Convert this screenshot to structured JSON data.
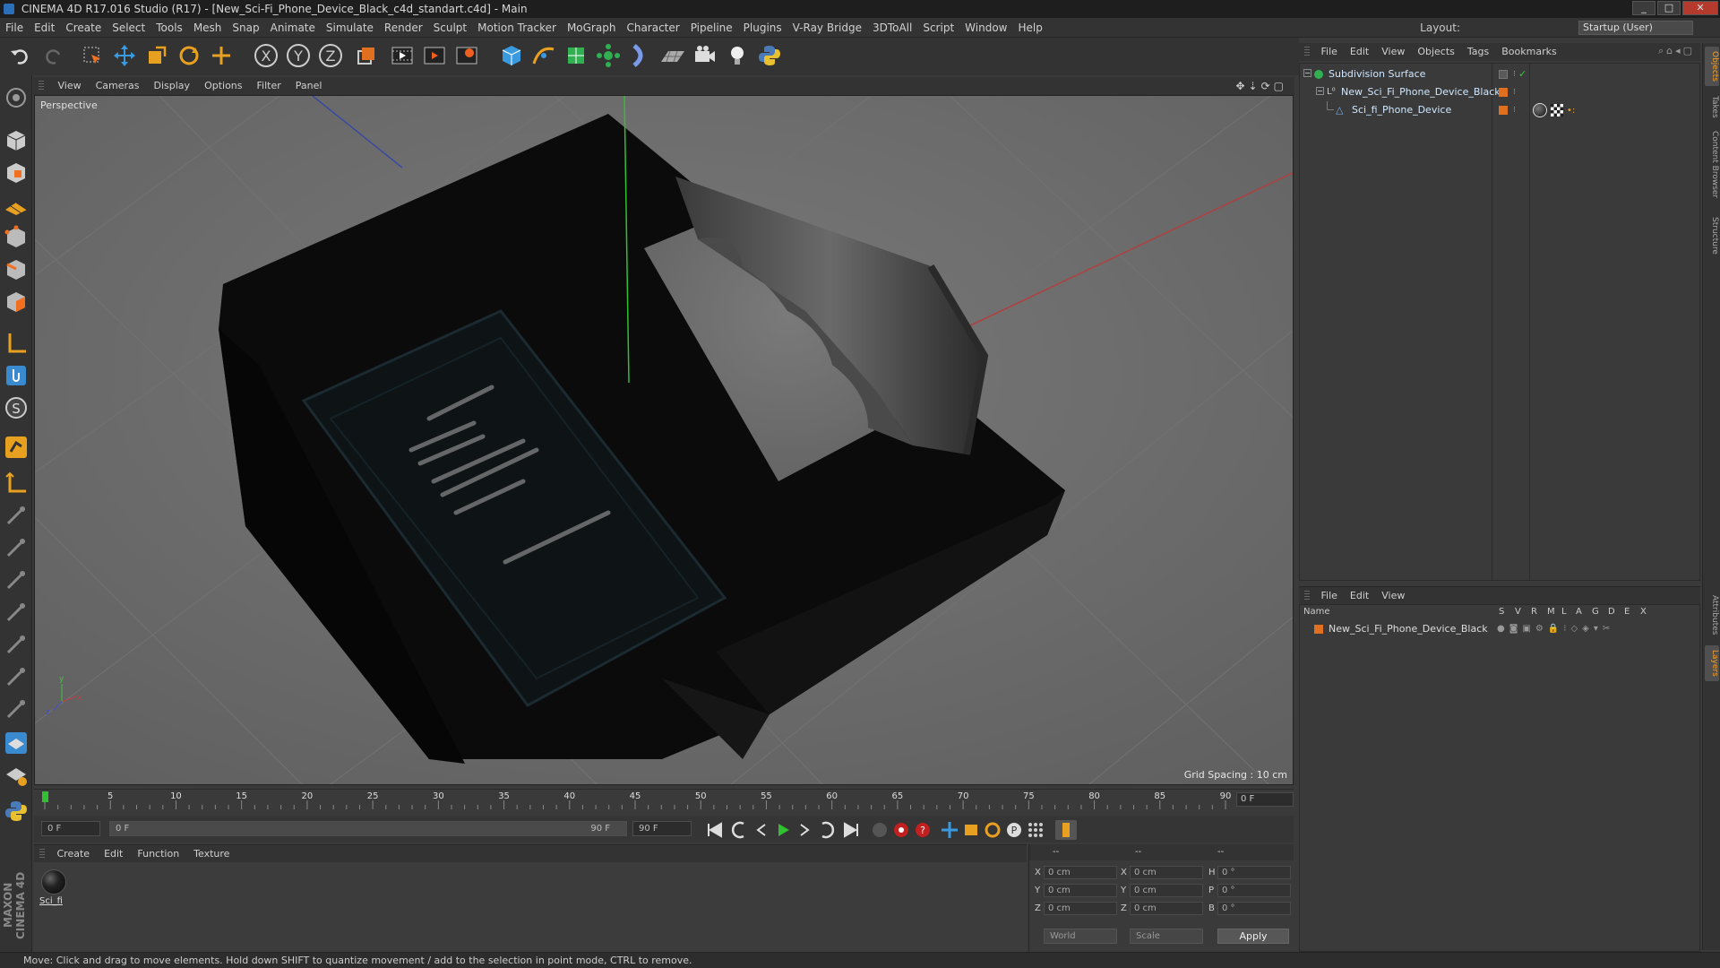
{
  "window": {
    "title": "CINEMA 4D R17.016 Studio (R17) - [New_Sci-Fi_Phone_Device_Black_c4d_standart.c4d] - Main",
    "min": "_",
    "max": "□",
    "close": "✕"
  },
  "menubar": {
    "items": [
      "File",
      "Edit",
      "Create",
      "Select",
      "Tools",
      "Mesh",
      "Snap",
      "Animate",
      "Simulate",
      "Render",
      "Sculpt",
      "Motion Tracker",
      "MoGraph",
      "Character",
      "Pipeline",
      "Plugins",
      "V-Ray Bridge",
      "3DToAll",
      "Script",
      "Window",
      "Help"
    ],
    "layout_label": "Layout:",
    "layout_value": "Startup (User)"
  },
  "toolbar": {
    "tools": [
      "undo-icon",
      "redo-icon",
      "live-select-icon",
      "move-icon",
      "scale-icon",
      "rotate-icon",
      "recent-tool-icon",
      "x-axis-icon",
      "y-axis-icon",
      "z-axis-icon",
      "coordinate-system-icon",
      "render-view-icon",
      "render-picture-viewer-icon",
      "edit-render-settings-icon",
      "cube-icon",
      "spline-pen-icon",
      "subdivision-icon",
      "array-icon",
      "deformer-icon",
      "floor-icon",
      "camera-icon",
      "light-icon",
      "python-icon"
    ],
    "x_label": "X",
    "y_label": "Y",
    "z_label": "Z"
  },
  "viewport": {
    "menu": [
      "View",
      "Cameras",
      "Display",
      "Options",
      "Filter",
      "Panel"
    ],
    "label": "Perspective",
    "grid_spacing": "Grid Spacing : 10 cm",
    "axis_x": "x",
    "axis_y": "y",
    "axis_z": "z"
  },
  "timeline": {
    "ticks": [
      "0",
      "5",
      "10",
      "15",
      "20",
      "25",
      "30",
      "35",
      "40",
      "45",
      "50",
      "55",
      "60",
      "65",
      "70",
      "75",
      "80",
      "85",
      "90"
    ],
    "current_frame": "0 F"
  },
  "transport": {
    "start_field": "0 F",
    "range_start": "0 F",
    "range_end": "90 F",
    "end_field": "90 F"
  },
  "material_manager": {
    "menu": [
      "Create",
      "Edit",
      "Function",
      "Texture"
    ],
    "materials": [
      {
        "name": "Sci_fi"
      }
    ]
  },
  "coordinates": {
    "headers": [
      "--",
      "--",
      "--"
    ],
    "rows": [
      {
        "axis": "X",
        "pos": "0 cm",
        "size_axis": "X",
        "size": "0 cm",
        "rot_axis": "H",
        "rot": "0 °"
      },
      {
        "axis": "Y",
        "pos": "0 cm",
        "size_axis": "Y",
        "size": "0 cm",
        "rot_axis": "P",
        "rot": "0 °"
      },
      {
        "axis": "Z",
        "pos": "0 cm",
        "size_axis": "Z",
        "size": "0 cm",
        "rot_axis": "B",
        "rot": "0 °"
      }
    ],
    "space": "World",
    "mode": "Scale",
    "apply": "Apply"
  },
  "object_manager": {
    "menu": [
      "File",
      "Edit",
      "View",
      "Objects",
      "Tags",
      "Bookmarks"
    ],
    "objects": [
      {
        "name": "Subdivision Surface",
        "color": "#5a5a5a"
      },
      {
        "name": "New_Sci_Fi_Phone_Device_Black",
        "color": "#e07020"
      },
      {
        "name": "Sci_fi_Phone_Device",
        "color": "#e07020"
      }
    ]
  },
  "layer_manager": {
    "menu": [
      "File",
      "Edit",
      "View"
    ],
    "columns": [
      "Name",
      "S",
      "V",
      "R",
      "M",
      "L",
      "A",
      "G",
      "D",
      "E",
      "X"
    ],
    "layers": [
      {
        "name": "New_Sci_Fi_Phone_Device_Black",
        "color": "#e07020"
      }
    ]
  },
  "right_tabs": [
    "Objects",
    "Takes",
    "Content Browser",
    "Structure",
    "Attributes",
    "Layers"
  ],
  "status": "Move: Click and drag to move elements. Hold down SHIFT to quantize movement / add to the selection in point mode, CTRL to remove."
}
